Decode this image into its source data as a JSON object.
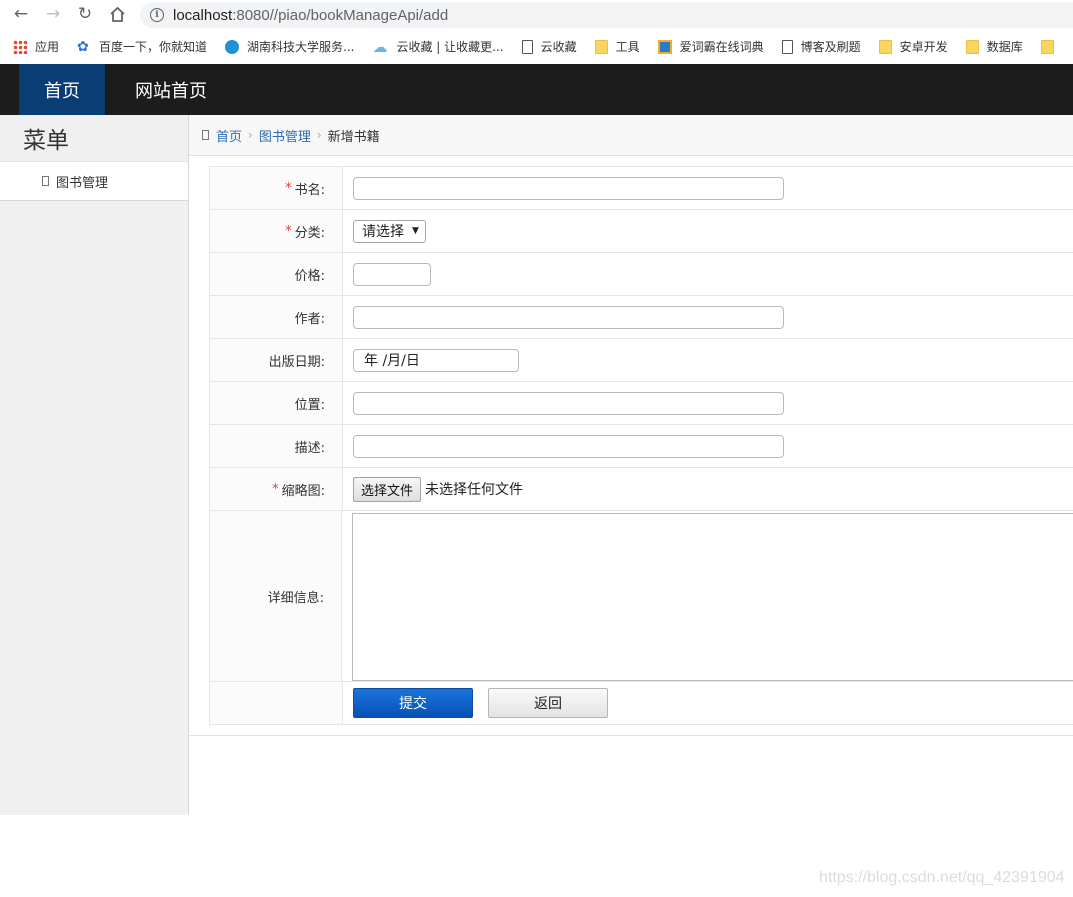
{
  "browser": {
    "url_host": "localhost",
    "url_rest": ":8080//piao/bookManageApi/add",
    "bookmarks": [
      "应用",
      "百度一下，你就知道",
      "湖南科技大学服务...",
      "云收藏 | 让收藏更...",
      "云收藏",
      "工具",
      "爱词霸在线词典",
      "博客及刷题",
      "安卓开发",
      "数据库"
    ]
  },
  "header": {
    "nav_home": "首页",
    "nav_site_home": "网站首页"
  },
  "sidebar": {
    "title": "菜单",
    "items": [
      {
        "label": "图书管理"
      }
    ]
  },
  "breadcrumb": {
    "home": "首页",
    "section": "图书管理",
    "current": "新增书籍"
  },
  "form": {
    "name_label": "书名:",
    "category_label": "分类:",
    "category_selected": "请选择",
    "price_label": "价格:",
    "author_label": "作者:",
    "date_label": "出版日期:",
    "date_placeholder": "年 /月/日",
    "location_label": "位置:",
    "desc_label": "描述:",
    "thumb_label": "缩略图:",
    "file_button": "选择文件",
    "file_status": "未选择任何文件",
    "detail_label": "详细信息:",
    "submit": "提交",
    "back": "返回",
    "required_mark": "*"
  },
  "watermark": "https://blog.csdn.net/qq_42391904"
}
